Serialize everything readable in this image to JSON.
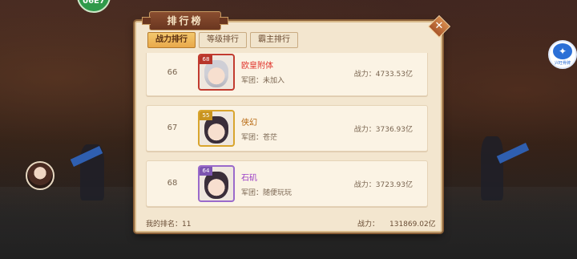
{
  "panel": {
    "title": "排行榜",
    "close_icon": "close-x-icon"
  },
  "tabs": [
    {
      "label": "战力排行",
      "active": true
    },
    {
      "label": "等级排行",
      "active": false
    },
    {
      "label": "霸主排行",
      "active": false
    }
  ],
  "rows": [
    {
      "rank": "66",
      "level": "68",
      "name": "欧皇附体",
      "name_color": "#e0322a",
      "guild_label": "军团：",
      "guild": "未加入",
      "power": "战力：4733.53亿",
      "frame": "red"
    },
    {
      "rank": "67",
      "level": "55",
      "name": "侠幻",
      "name_color": "#b86a12",
      "guild_label": "军团：",
      "guild": "苍茫",
      "power": "战力：3736.93亿",
      "frame": "gold"
    },
    {
      "rank": "68",
      "level": "64",
      "name": "石矶",
      "name_color": "#9b3fc6",
      "guild_label": "军团：",
      "guild": "随便玩玩",
      "power": "战力：3723.93亿",
      "frame": "purple"
    }
  ],
  "footer": {
    "my_rank_label": "我的排名：11",
    "power_label": "战力：",
    "power_value": "131869.02亿"
  },
  "hud": {
    "top_badge": "06E7",
    "side_badge_label": "兴旺骨牌"
  }
}
